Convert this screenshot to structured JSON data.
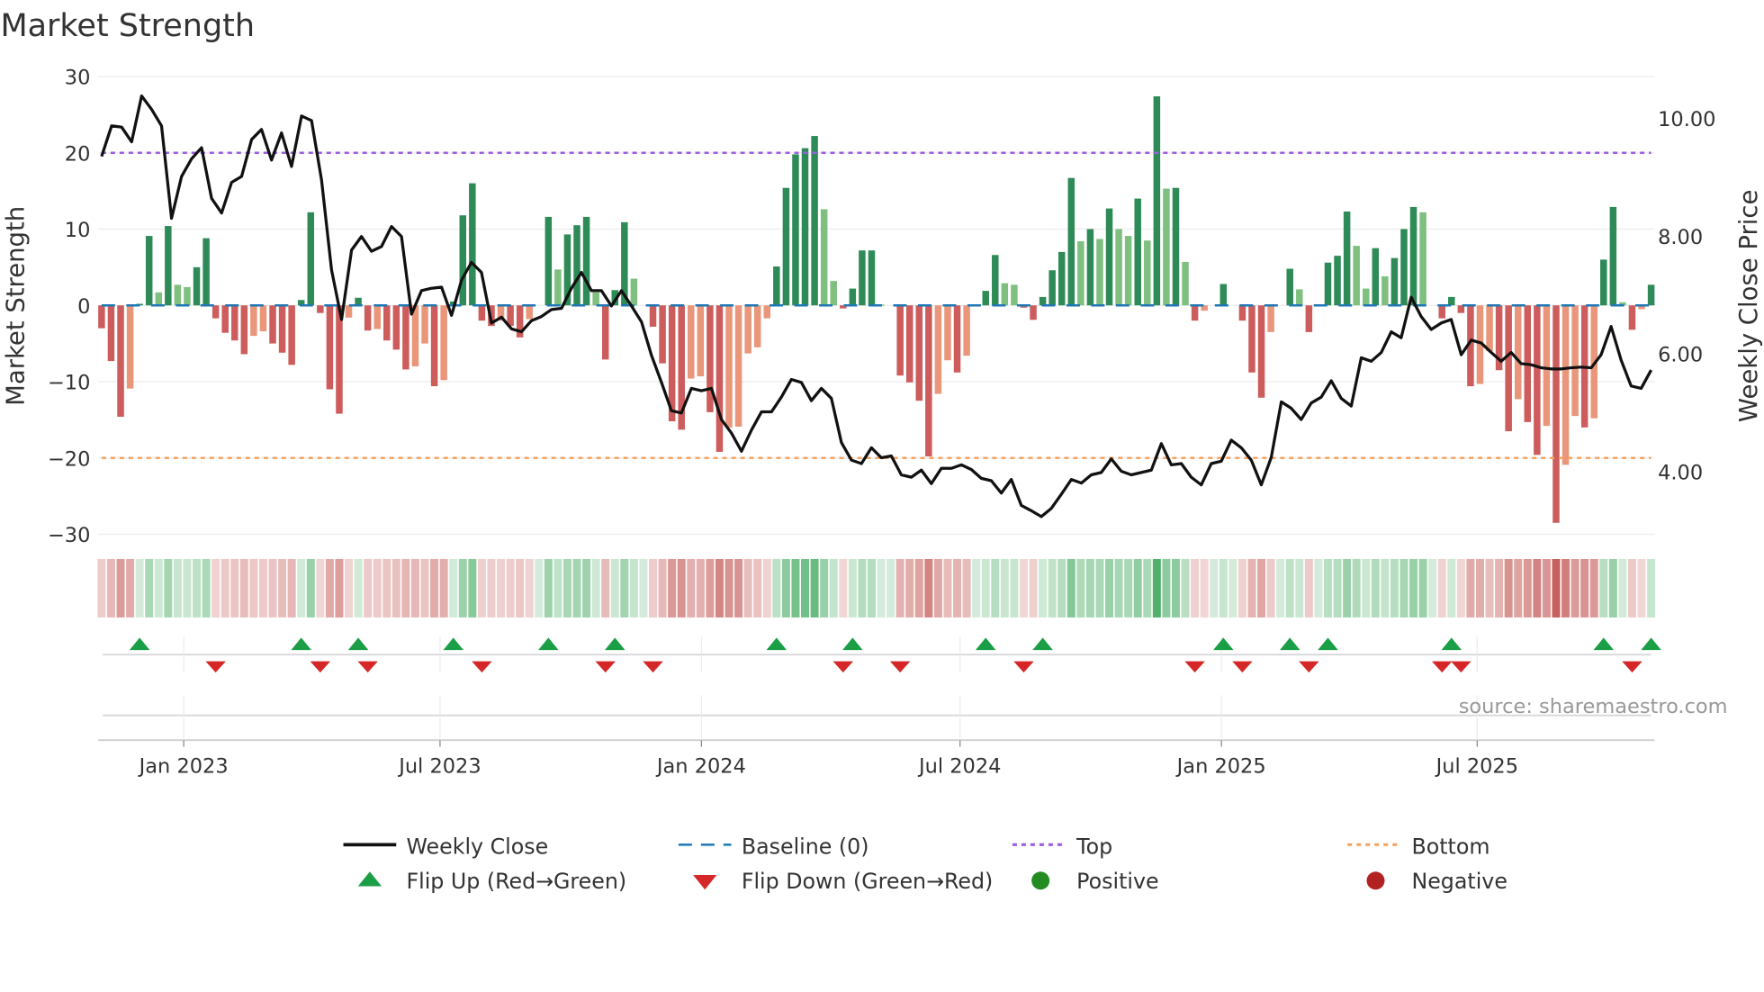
{
  "chart_data": {
    "type": "bar+line",
    "title": "Market Strength",
    "ylabel": "Market Strength",
    "ylabel_right": "Weekly Close Price",
    "ylim": [
      -30,
      30
    ],
    "ylim_right": [
      2.93,
      10.71
    ],
    "yticks": [
      -30,
      -20,
      -10,
      0,
      10,
      20,
      30
    ],
    "yticks_right": [
      "4.00",
      "6.00",
      "8.00",
      "10.00"
    ],
    "yticks_right_values": [
      4,
      6,
      8,
      10
    ],
    "x_ticks": [
      {
        "label": "Jan 2023",
        "week": 9.64
      },
      {
        "label": "Jul 2023",
        "week": 36.6
      },
      {
        "label": "Jan 2024",
        "week": 64.1
      },
      {
        "label": "Jul 2024",
        "week": 91.3
      },
      {
        "label": "Jan 2025",
        "week": 118.8
      },
      {
        "label": "Jul 2025",
        "week": 145.7
      }
    ],
    "top_level": 20,
    "bottom_level": -20,
    "baseline": 0,
    "strength": [
      -3,
      -7.3,
      -14.6,
      -10.9,
      0.2,
      9.1,
      1.7,
      10.4,
      2.7,
      2.4,
      5,
      8.8,
      -1.7,
      -3.6,
      -4.6,
      -6.4,
      -4,
      -3.4,
      -5,
      -6.2,
      -7.8,
      0.7,
      12.2,
      -1,
      -11,
      -14.2,
      -1.6,
      1,
      -3.3,
      -3.1,
      -4.6,
      -5.8,
      -8.4,
      -8,
      -5,
      -10.6,
      -9.8,
      0.5,
      11.8,
      16,
      -2,
      -2.7,
      -2,
      -2.7,
      -4.2,
      -1.8,
      0,
      11.6,
      4.7,
      9.3,
      10.5,
      11.6,
      1.7,
      -7.1,
      2,
      10.9,
      3.5,
      0,
      -2.8,
      -7.6,
      -15.2,
      -16.3,
      -9.6,
      -9.3,
      -14,
      -19.2,
      -16,
      -15.9,
      -6.3,
      -5.5,
      -1.7,
      5.1,
      15.4,
      19.8,
      20.6,
      22.2,
      12.6,
      3.2,
      -0.4,
      2.2,
      7.2,
      7.2,
      0.1,
      0,
      -9.2,
      -10.1,
      -12.5,
      -19.8,
      -11.6,
      -7.2,
      -8.8,
      -6.6,
      0,
      1.9,
      6.6,
      2.9,
      2.7,
      -0.3,
      -1.9,
      1.1,
      4.6,
      7,
      16.7,
      8.4,
      10,
      8.7,
      12.7,
      10,
      9.1,
      14,
      8.5,
      27.4,
      15.3,
      15.4,
      5.7,
      -2,
      -0.7,
      0,
      2.8,
      0,
      -2,
      -8.8,
      -12.1,
      -3.5,
      0,
      4.8,
      2.1,
      -3.5,
      0,
      5.6,
      6.5,
      12.3,
      7.8,
      2.2,
      7.5,
      3.8,
      6.2,
      10,
      12.9,
      12.2,
      0,
      -1.7,
      1.1,
      -1,
      -10.6,
      -10.3,
      -6,
      -8.5,
      -16.5,
      -12.3,
      -15.3,
      -19.6,
      -15.8,
      -28.5,
      -20.9,
      -14.5,
      -16,
      -14.8,
      6,
      12.9,
      0.4,
      -3.2,
      -0.5,
      2.7
    ],
    "weak_weeks": [
      4,
      7,
      9,
      10,
      17,
      18,
      27,
      30,
      34,
      35,
      37,
      43,
      46,
      49,
      53,
      57,
      63,
      64,
      67,
      68,
      69,
      70,
      71,
      77,
      78,
      83,
      89,
      90,
      92,
      96,
      97,
      104,
      106,
      108,
      109,
      111,
      113,
      115,
      117,
      124,
      127,
      133,
      134,
      136,
      140,
      146,
      147,
      150,
      153,
      155,
      156,
      158,
      161,
      163
    ],
    "weekly_close": [
      9.35,
      9.87,
      9.85,
      9.6,
      10.38,
      10.15,
      9.87,
      8.3,
      9.01,
      9.31,
      9.5,
      8.64,
      8.39,
      8.91,
      9.01,
      9.64,
      9.81,
      9.29,
      9.75,
      9.18,
      10.04,
      9.96,
      8.95,
      7.42,
      6.58,
      7.76,
      7.99,
      7.74,
      7.82,
      8.16,
      7.99,
      6.67,
      7.07,
      7.11,
      7.13,
      6.65,
      7.25,
      7.55,
      7.38,
      6.52,
      6.62,
      6.42,
      6.37,
      6.56,
      6.63,
      6.75,
      6.77,
      7.11,
      7.38,
      7.07,
      7.07,
      6.81,
      7.07,
      6.81,
      6.54,
      5.97,
      5.51,
      5.03,
      4.99,
      5.41,
      5.37,
      5.41,
      4.88,
      4.65,
      4.34,
      4.7,
      5.01,
      5.01,
      5.26,
      5.56,
      5.51,
      5.2,
      5.41,
      5.24,
      4.49,
      4.19,
      4.13,
      4.4,
      4.23,
      4.26,
      3.94,
      3.9,
      4.02,
      3.79,
      4.05,
      4.05,
      4.11,
      4.03,
      3.88,
      3.84,
      3.63,
      3.86,
      3.42,
      3.33,
      3.23,
      3.37,
      3.61,
      3.86,
      3.8,
      3.94,
      3.98,
      4.21,
      4.0,
      3.94,
      3.98,
      4.02,
      4.47,
      4.11,
      4.13,
      3.9,
      3.77,
      4.13,
      4.17,
      4.53,
      4.4,
      4.19,
      3.77,
      4.24,
      5.18,
      5.07,
      4.88,
      5.16,
      5.26,
      5.54,
      5.24,
      5.11,
      5.93,
      5.87,
      6.02,
      6.37,
      6.27,
      6.96,
      6.63,
      6.41,
      6.52,
      6.58,
      5.98,
      6.23,
      6.18,
      6.02,
      5.87,
      6.02,
      5.83,
      5.81,
      5.76,
      5.74,
      5.74,
      5.76,
      5.77,
      5.76,
      5.98,
      6.46,
      5.89,
      5.45,
      5.41,
      5.72
    ],
    "flip_up_weeks": [
      5,
      22,
      28,
      38,
      48,
      55,
      72,
      80,
      94,
      100,
      119,
      126,
      130,
      143,
      159,
      164
    ],
    "flip_down_weeks": [
      13,
      24,
      29,
      41,
      54,
      59,
      79,
      85,
      98,
      116,
      121,
      128,
      142,
      144,
      162
    ],
    "legend": {
      "weekly_close": "Weekly Close",
      "baseline": "Baseline (0)",
      "top": "Top",
      "bottom": "Bottom",
      "flip_up": "Flip Up (Red→Green)",
      "flip_down": "Flip Down (Green→Red)",
      "positive": "Positive",
      "negative": "Negative"
    },
    "legend_placement": "bottom",
    "source": "source: sharemaestro.com",
    "colors": {
      "pos_strong": "#2e8b57",
      "pos_weak": "#7fbf7f",
      "neg_strong": "#cd5c5c",
      "neg_weak": "#e9967a",
      "line": "#111111",
      "baseline": "#1f77b4",
      "top": "#9b5fe0",
      "bottom": "#f4a460",
      "flip_up": "#1a9e46",
      "flip_down": "#d62728",
      "positive": "#228b22",
      "negative": "#b22222"
    }
  }
}
